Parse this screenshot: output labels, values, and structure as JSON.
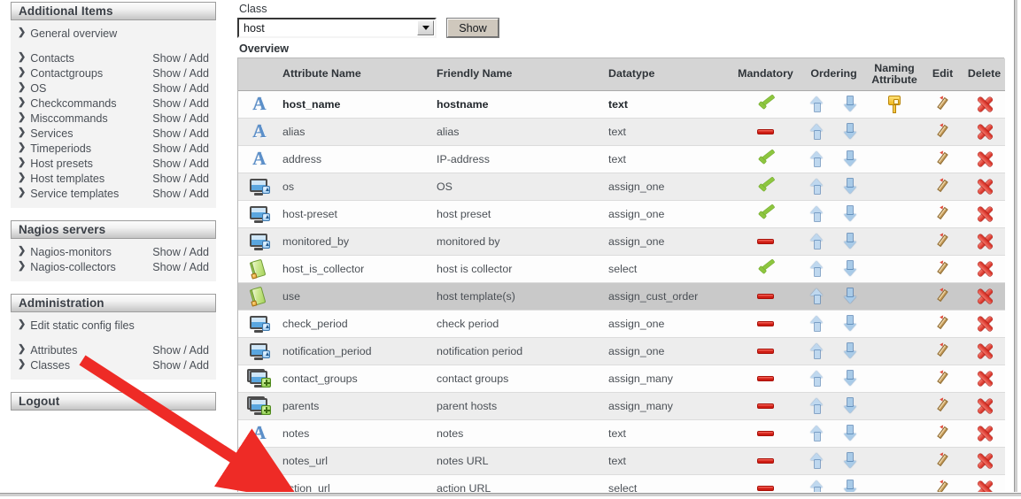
{
  "sidebar": {
    "panels": [
      {
        "title": "Additional Items",
        "items": [
          {
            "label": "General overview",
            "action": "",
            "gap_after": true
          },
          {
            "label": "Contacts",
            "action": "Show / Add"
          },
          {
            "label": "Contactgroups",
            "action": "Show / Add"
          },
          {
            "label": "OS",
            "action": "Show / Add"
          },
          {
            "label": "Checkcommands",
            "action": "Show / Add"
          },
          {
            "label": "Misccommands",
            "action": "Show / Add"
          },
          {
            "label": "Services",
            "action": "Show / Add"
          },
          {
            "label": "Timeperiods",
            "action": "Show / Add"
          },
          {
            "label": "Host presets",
            "action": "Show / Add"
          },
          {
            "label": "Host templates",
            "action": "Show / Add"
          },
          {
            "label": "Service templates",
            "action": "Show / Add"
          }
        ]
      },
      {
        "title": "Nagios servers",
        "items": [
          {
            "label": "Nagios-monitors",
            "action": "Show / Add"
          },
          {
            "label": "Nagios-collectors",
            "action": "Show / Add"
          }
        ]
      },
      {
        "title": "Administration",
        "items": [
          {
            "label": "Edit static config files",
            "action": "",
            "gap_after": true
          },
          {
            "label": "Attributes",
            "action": "Show / Add"
          },
          {
            "label": "Classes",
            "action": "Show / Add"
          }
        ]
      },
      {
        "title": "Logout",
        "items": []
      }
    ]
  },
  "main": {
    "class_label": "Class",
    "class_value": "host",
    "show_button": "Show",
    "overview_label": "Overview",
    "columns": [
      "",
      "Attribute Name",
      "Friendly Name",
      "Datatype",
      "Mandatory",
      "Ordering",
      "Naming Attribute",
      "Edit",
      "Delete"
    ],
    "naming_col_line1": "Naming",
    "naming_col_line2": "Attribute",
    "rows": [
      {
        "icon": "letter-a-icon",
        "attribute": "host_name",
        "friendly": "hostname",
        "datatype": "text",
        "mandatory": "check",
        "naming": true,
        "highlight": false
      },
      {
        "icon": "letter-a-icon",
        "attribute": "alias",
        "friendly": "alias",
        "datatype": "text",
        "mandatory": "minus",
        "naming": false,
        "highlight": false
      },
      {
        "icon": "letter-a-icon",
        "attribute": "address",
        "friendly": "IP-address",
        "datatype": "text",
        "mandatory": "check",
        "naming": false,
        "highlight": false
      },
      {
        "icon": "monitor-icon",
        "attribute": "os",
        "friendly": "OS",
        "datatype": "assign_one",
        "mandatory": "check",
        "naming": false,
        "highlight": false
      },
      {
        "icon": "monitor-icon",
        "attribute": "host-preset",
        "friendly": "host preset",
        "datatype": "assign_one",
        "mandatory": "check",
        "naming": false,
        "highlight": false
      },
      {
        "icon": "monitor-icon",
        "attribute": "monitored_by",
        "friendly": "monitored by",
        "datatype": "assign_one",
        "mandatory": "minus",
        "naming": false,
        "highlight": false
      },
      {
        "icon": "green-book-icon",
        "attribute": "host_is_collector",
        "friendly": "host is collector",
        "datatype": "select",
        "mandatory": "check",
        "naming": false,
        "highlight": false
      },
      {
        "icon": "green-book-icon",
        "attribute": "use",
        "friendly": "host template(s)",
        "datatype": "assign_cust_order",
        "mandatory": "minus",
        "naming": false,
        "highlight": true
      },
      {
        "icon": "monitor-icon",
        "attribute": "check_period",
        "friendly": "check period",
        "datatype": "assign_one",
        "mandatory": "minus",
        "naming": false,
        "highlight": false
      },
      {
        "icon": "monitor-icon",
        "attribute": "notification_period",
        "friendly": "notification period",
        "datatype": "assign_one",
        "mandatory": "minus",
        "naming": false,
        "highlight": false
      },
      {
        "icon": "monitor-stack-icon",
        "attribute": "contact_groups",
        "friendly": "contact groups",
        "datatype": "assign_many",
        "mandatory": "minus",
        "naming": false,
        "highlight": false
      },
      {
        "icon": "monitor-stack-icon",
        "attribute": "parents",
        "friendly": "parent hosts",
        "datatype": "assign_many",
        "mandatory": "minus",
        "naming": false,
        "highlight": false
      },
      {
        "icon": "letter-a-icon",
        "attribute": "notes",
        "friendly": "notes",
        "datatype": "text",
        "mandatory": "minus",
        "naming": false,
        "highlight": false
      },
      {
        "icon": "letter-a-icon",
        "attribute": "notes_url",
        "friendly": "notes URL",
        "datatype": "text",
        "mandatory": "minus",
        "naming": false,
        "highlight": false
      },
      {
        "icon": "green-book-icon",
        "attribute": "action_url",
        "friendly": "action URL",
        "datatype": "select",
        "mandatory": "minus",
        "naming": false,
        "highlight": false
      }
    ]
  },
  "annotation": {
    "color": "#ee2b26",
    "from": "Attributes",
    "to": "action_url"
  }
}
